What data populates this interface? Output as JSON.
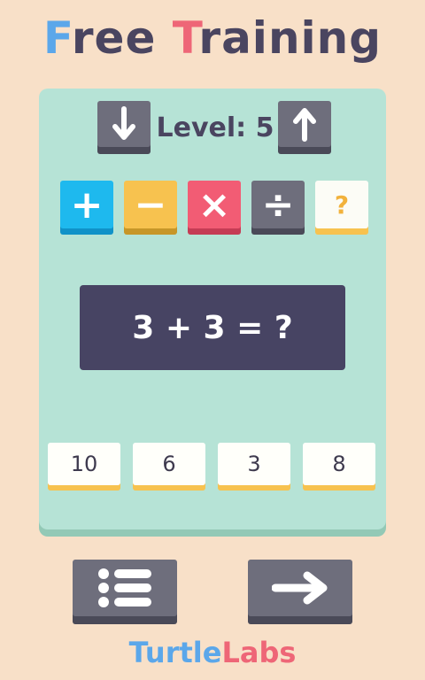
{
  "title": {
    "first_cap": "F",
    "first_rest": "ree ",
    "second_cap": "T",
    "second_rest": "raining"
  },
  "level": {
    "label": "Level: 5",
    "down_icon": "arrow-down-icon",
    "up_icon": "arrow-up-icon"
  },
  "operations": [
    {
      "name": "plus",
      "symbol": "+",
      "color": "#1eb9ee"
    },
    {
      "name": "minus",
      "symbol": "−",
      "color": "#f7c24f"
    },
    {
      "name": "times",
      "symbol": "×",
      "color": "#f25c74"
    },
    {
      "name": "divide",
      "symbol": "÷",
      "color": "#6e6e7c"
    },
    {
      "name": "random",
      "symbol": "?",
      "color": "#fcfcf6"
    }
  ],
  "equation": "3 + 3 = ?",
  "answers": [
    "10",
    "6",
    "3",
    "8"
  ],
  "bottom": {
    "menu_icon": "list-menu-icon",
    "next_icon": "arrow-right-icon"
  },
  "footer": {
    "part1": "Turtle",
    "part2": "Labs"
  },
  "colors": {
    "background": "#f8e0c8",
    "panel": "#b6e3d6",
    "equation_bg": "#474463",
    "accent_blue": "#5ba7ea",
    "accent_red": "#ee6677"
  }
}
